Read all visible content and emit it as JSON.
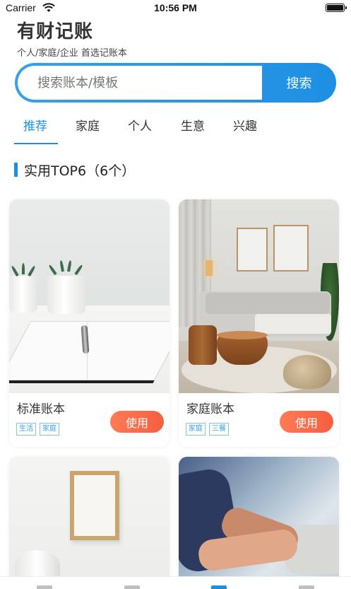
{
  "status_bar": {
    "carrier": "Carrier",
    "time": "10:56 PM"
  },
  "header": {
    "title": "有财记账",
    "subtitle": "个人/家庭/企业 首选记账本"
  },
  "search": {
    "placeholder": "搜索账本/模板",
    "button_label": "搜索"
  },
  "tabs": [
    {
      "label": "推荐",
      "active": true
    },
    {
      "label": "家庭",
      "active": false
    },
    {
      "label": "个人",
      "active": false
    },
    {
      "label": "生意",
      "active": false
    },
    {
      "label": "兴趣",
      "active": false
    }
  ],
  "section": {
    "title": "实用TOP6（6个）"
  },
  "cards": [
    {
      "name": "标准账本",
      "tags": [
        "生活",
        "家庭"
      ],
      "button_label": "使用"
    },
    {
      "name": "家庭账本",
      "tags": [
        "家庭",
        "三餐"
      ],
      "button_label": "使用"
    }
  ],
  "colors": {
    "accent": "#1d8fe3",
    "use_button": "#f86a48",
    "tag": "#3a9fe6"
  },
  "icons": [
    "wifi-icon",
    "battery-icon"
  ]
}
